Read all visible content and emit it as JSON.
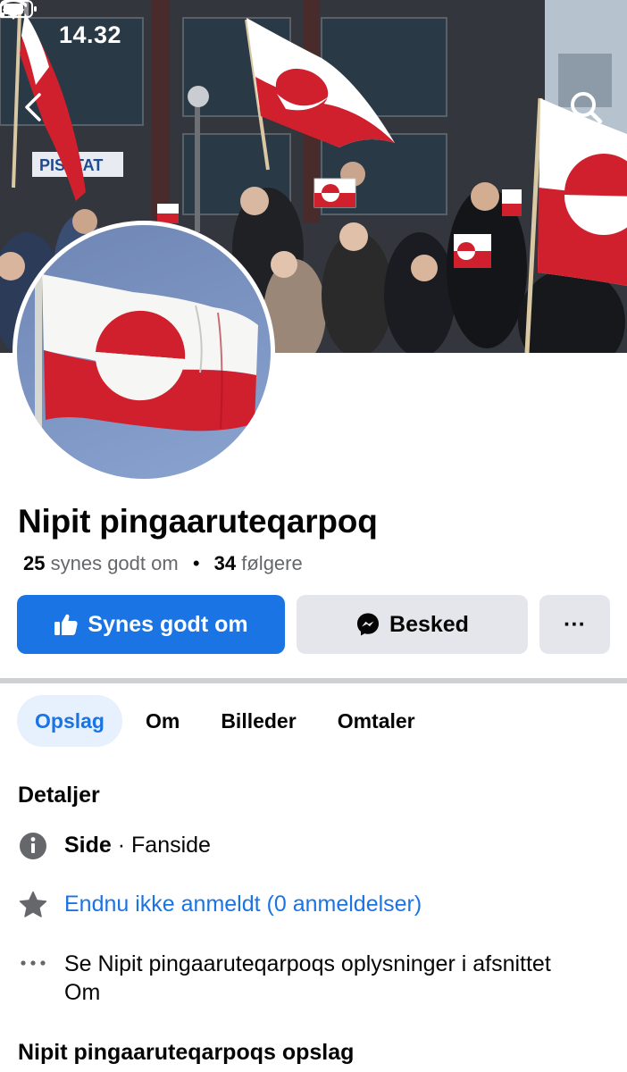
{
  "status": {
    "time": "14.32"
  },
  "cover": {
    "sign_text": "PISI TAT"
  },
  "page": {
    "name": "Nipit pingaaruteqarpoq",
    "likes_count": "25",
    "likes_label": "synes godt om",
    "followers_count": "34",
    "followers_label": "følgere"
  },
  "actions": {
    "like_label": "Synes godt om",
    "message_label": "Besked",
    "more_label": "···"
  },
  "tabs": [
    {
      "label": "Opslag",
      "active": true
    },
    {
      "label": "Om",
      "active": false
    },
    {
      "label": "Billeder",
      "active": false
    },
    {
      "label": "Omtaler",
      "active": false
    }
  ],
  "details": {
    "title": "Detaljer",
    "type_label": "Side",
    "type_value": "· Fanside",
    "reviews_link": "Endnu ikke anmeldt (0 anmeldelser)",
    "about_text": "Se Nipit pingaaruteqarpoqs oplysninger i afsnittet Om"
  },
  "posts_title": "Nipit pingaaruteqarpoqs opslag",
  "colors": {
    "brand_blue": "#1b74e4",
    "flag_red": "#d0202e",
    "flag_white": "#ffffff",
    "button_gray": "#e4e6eb"
  },
  "icons": {
    "back": "chevron-left-icon",
    "search": "search-icon",
    "like": "thumbs-up-icon",
    "message": "messenger-icon",
    "info": "info-icon",
    "star": "star-icon",
    "more": "more-dots-icon"
  }
}
